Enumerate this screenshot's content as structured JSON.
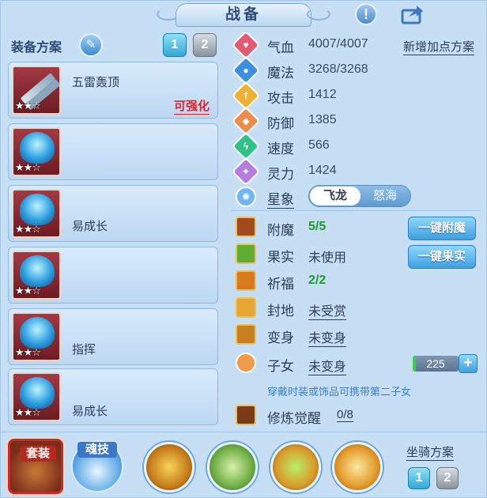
{
  "header": {
    "title": "战备"
  },
  "left": {
    "plan_title": "装备方案",
    "plan_tabs": [
      "1",
      "2"
    ],
    "slots": [
      {
        "name": "五雷轰顶",
        "stars": "★★☆",
        "enhance": "可强化"
      },
      {
        "name": "",
        "stars": "★★☆"
      },
      {
        "name": "易成长",
        "stars": "★★☆"
      },
      {
        "name": "",
        "stars": "★★☆"
      },
      {
        "name": "指挥",
        "stars": "★★☆"
      },
      {
        "name": "易成长",
        "stars": "★★☆"
      }
    ]
  },
  "stats": {
    "add_points": "新增加点方案",
    "rows": [
      {
        "label": "气血",
        "value": "4007/4007",
        "icon": "heart-icon",
        "color": "#e35a73"
      },
      {
        "label": "魔法",
        "value": "3268/3268",
        "icon": "mana-icon",
        "color": "#3f8fe0"
      },
      {
        "label": "攻击",
        "value": "1412",
        "icon": "attack-icon",
        "color": "#f0b032"
      },
      {
        "label": "防御",
        "value": "1385",
        "icon": "defense-icon",
        "color": "#f08a4a"
      },
      {
        "label": "速度",
        "value": "566",
        "icon": "speed-icon",
        "color": "#2fc38b"
      },
      {
        "label": "灵力",
        "value": "1424",
        "icon": "spirit-icon",
        "color": "#b57de0"
      }
    ],
    "star_label": "星象",
    "star_options": [
      "飞龙",
      "怒海"
    ]
  },
  "enhance": {
    "rows": [
      {
        "label": "附魔",
        "value": "5/5",
        "type": "green"
      },
      {
        "label": "果实",
        "value": "未使用",
        "type": "plain"
      },
      {
        "label": "祈福",
        "value": "2/2",
        "type": "green"
      },
      {
        "label": "封地",
        "value": "未受赏",
        "type": "underline"
      },
      {
        "label": "变身",
        "value": "未变身",
        "type": "underline"
      },
      {
        "label": "子女",
        "value": "未变身",
        "type": "underline"
      }
    ],
    "buttons": [
      "一键附魔",
      "一键果实"
    ],
    "child_value": "225",
    "child_hint": "穿戴时装或饰品可携带第二子女",
    "cultivate_label": "修炼觉醒",
    "cultivate_value": "0/8"
  },
  "bottom": {
    "set_label": "套装",
    "soul_label": "魂技",
    "mount_title": "坐骑方案",
    "mount_tabs": [
      "1",
      "2"
    ]
  }
}
